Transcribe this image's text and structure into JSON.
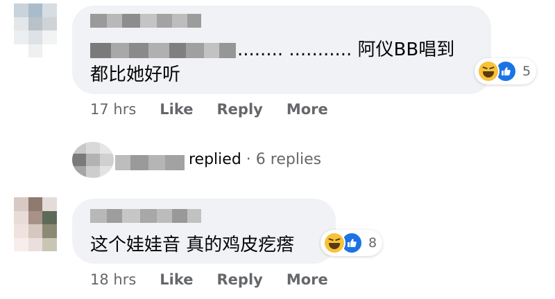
{
  "comments": [
    {
      "text_line1": "........ ........... 阿仪BB唱到",
      "text_line2": "都比她好听",
      "reaction_count": "5",
      "time": "17 hrs",
      "like_label": "Like",
      "reply_label": "Reply",
      "more_label": "More",
      "reaction_icons": [
        "haha-icon",
        "like-icon"
      ]
    },
    {
      "text_line1": "这个娃娃音 真的鸡皮疙瘩",
      "reaction_count": "8",
      "time": "18 hrs",
      "like_label": "Like",
      "reply_label": "Reply",
      "more_label": "More",
      "reaction_icons": [
        "haha-icon",
        "like-icon"
      ]
    }
  ],
  "replies_summary": {
    "replied_label": "replied",
    "separator": "·",
    "count_label": "6 replies"
  },
  "colors": {
    "bubble": "#f0f2f5",
    "meta_text": "#65676b",
    "like_blue": "#1b74e4",
    "haha_yellow": "#f7c23a"
  }
}
